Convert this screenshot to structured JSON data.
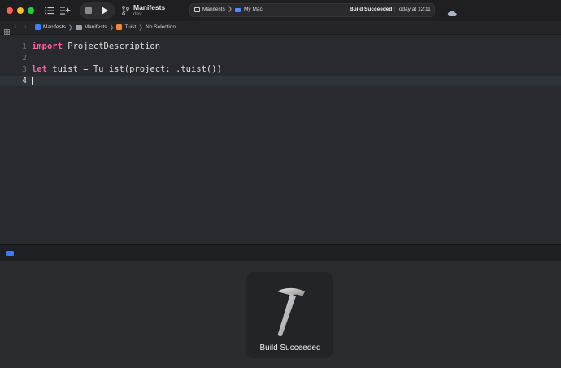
{
  "toolbar": {
    "project_name": "Manifests",
    "branch": "dev",
    "scheme": "Manifests",
    "scheme_sep": "❯",
    "destination": "My Mac",
    "status_bold": "Build Succeeded",
    "status_sep": " | ",
    "status_time": "Today at 12:11",
    "icons": [
      "navigator-icon",
      "library-icon",
      "stop-icon",
      "run-icon",
      "branch-icon",
      "cloud-icon"
    ]
  },
  "jumpbar": {
    "back": "‹",
    "forward": "›",
    "crumbs": [
      "Manifests",
      "Manifests",
      "Tuist",
      "No Selection"
    ],
    "sep": "❯"
  },
  "editor": {
    "lines": [
      {
        "number": "1"
      },
      {
        "number": "2"
      },
      {
        "number": "3"
      },
      {
        "number": "4"
      }
    ],
    "line1_kw": "import",
    "line1_rest": " ProjectDescription",
    "line3_kw": "let",
    "line3_rest": " tuist = Tu ist(project: .tuist())"
  },
  "hud": {
    "label": "Build Succeeded"
  },
  "colors": {
    "keyword": "#fc5fa3",
    "accent": "#3b7cf6",
    "background": "#292a30"
  }
}
